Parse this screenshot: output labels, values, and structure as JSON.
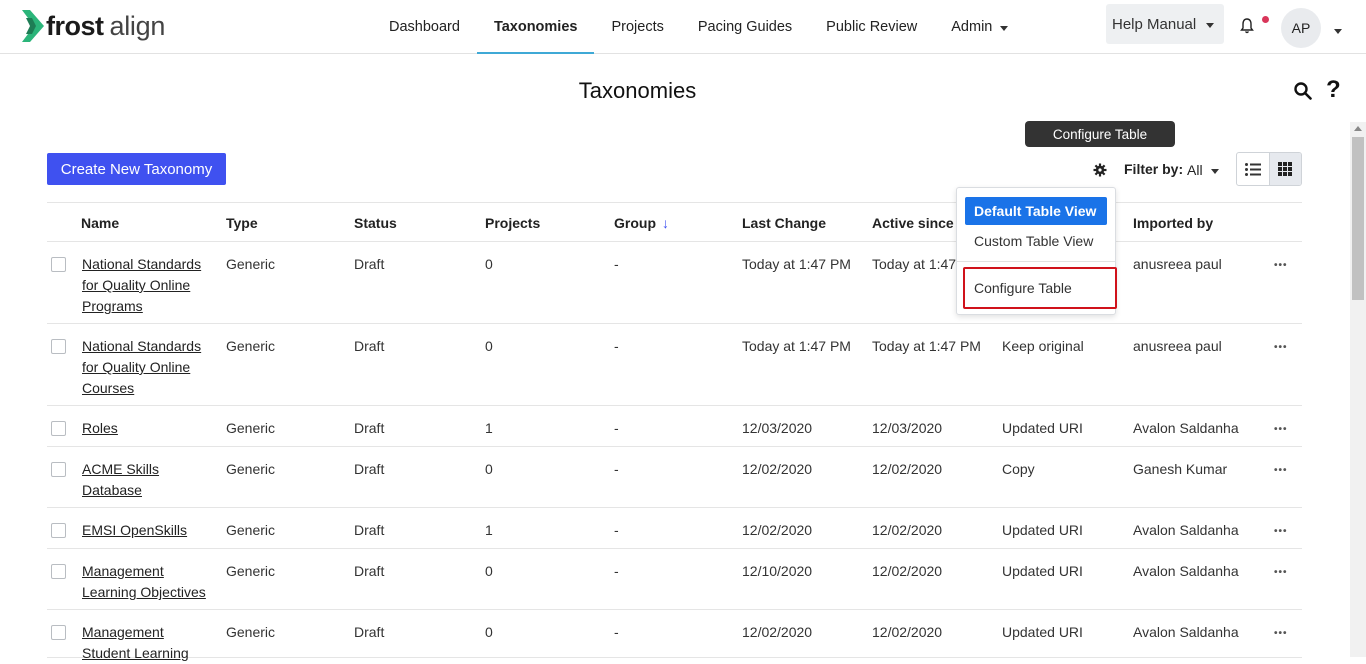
{
  "app": {
    "logo_bold": "frost",
    "logo_light": "align"
  },
  "nav": {
    "items": [
      {
        "label": "Dashboard"
      },
      {
        "label": "Taxonomies"
      },
      {
        "label": "Projects"
      },
      {
        "label": "Pacing Guides"
      },
      {
        "label": "Public Review"
      },
      {
        "label": "Admin"
      }
    ],
    "active": "Taxonomies"
  },
  "header": {
    "help_label": "Help Manual",
    "avatar_initials": "AP"
  },
  "page": {
    "title": "Taxonomies",
    "create_label": "Create New Taxonomy",
    "tooltip": "Configure Table",
    "filter_label": "Filter by:",
    "filter_value": "All"
  },
  "dropdown": {
    "items": [
      {
        "label": "Default Table View"
      },
      {
        "label": "Custom Table View"
      },
      {
        "label": "Configure Table"
      }
    ]
  },
  "table": {
    "columns": [
      "Name",
      "Type",
      "Status",
      "Projects",
      "Group",
      "Last Change",
      "Active since",
      "",
      "Imported by"
    ],
    "rows": [
      {
        "name": [
          "National Standards",
          "for Quality Online",
          "Programs"
        ],
        "type": "Generic",
        "status": "Draft",
        "projects": "0",
        "group": "-",
        "last_change": "Today at 1:47 PM",
        "active_since": "Today at 1:47",
        "method": "",
        "imported_by": "anusreea paul"
      },
      {
        "name": [
          "National Standards",
          "for Quality Online",
          "Courses"
        ],
        "type": "Generic",
        "status": "Draft",
        "projects": "0",
        "group": "-",
        "last_change": "Today at 1:47 PM",
        "active_since": "Today at 1:47 PM",
        "method": "Keep original",
        "imported_by": "anusreea paul"
      },
      {
        "name": [
          "Roles"
        ],
        "type": "Generic",
        "status": "Draft",
        "projects": "1",
        "group": "-",
        "last_change": "12/03/2020",
        "active_since": "12/03/2020",
        "method": "Updated URI",
        "imported_by": "Avalon Saldanha"
      },
      {
        "name": [
          "ACME Skills",
          "Database"
        ],
        "type": "Generic",
        "status": "Draft",
        "projects": "0",
        "group": "-",
        "last_change": "12/02/2020",
        "active_since": "12/02/2020",
        "method": "Copy",
        "imported_by": "Ganesh Kumar"
      },
      {
        "name": [
          "EMSI OpenSkills"
        ],
        "type": "Generic",
        "status": "Draft",
        "projects": "1",
        "group": "-",
        "last_change": "12/02/2020",
        "active_since": "12/02/2020",
        "method": "Updated URI",
        "imported_by": "Avalon Saldanha"
      },
      {
        "name": [
          "Management",
          "Learning Objectives"
        ],
        "type": "Generic",
        "status": "Draft",
        "projects": "0",
        "group": "-",
        "last_change": "12/10/2020",
        "active_since": "12/02/2020",
        "method": "Updated URI",
        "imported_by": "Avalon Saldanha"
      },
      {
        "name": [
          "Management",
          "Student Learning"
        ],
        "type": "Generic",
        "status": "Draft",
        "projects": "0",
        "group": "-",
        "last_change": "12/02/2020",
        "active_since": "12/02/2020",
        "method": "Updated URI",
        "imported_by": "Avalon Saldanha"
      }
    ]
  },
  "colors": {
    "primary_button": "#3f51f0",
    "nav_underline": "#3fa9d6",
    "dropdown_selected": "#1a73e8",
    "highlight_border": "#d0121b",
    "notification_dot": "#d9365a"
  },
  "icons": [
    "search-icon",
    "help-icon",
    "bell-icon",
    "gear-icon",
    "list-view-icon",
    "grid-view-icon",
    "more-options-icon",
    "sort-arrow-icon"
  ]
}
